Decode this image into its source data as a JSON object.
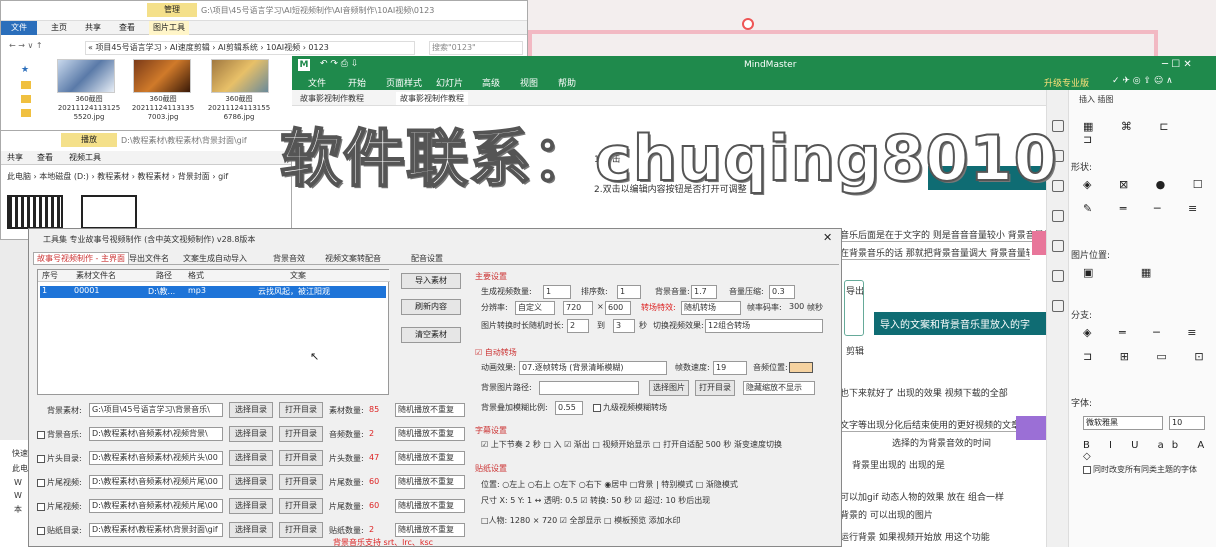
{
  "explorer1": {
    "path": "G:\\项目\\45号语言学习\\AI短视频制作\\AI音频制作\\10AI视频\\0123",
    "tabs": [
      "文件",
      "主页",
      "共享",
      "查看"
    ],
    "tool_tab": "图片工具",
    "manage": "管理",
    "breadcrumb": "« 项目45号语言学习 › AI速度剪辑 › AI剪辑系统 › 10AI视频 › 0123",
    "search": "搜索\"0123\"",
    "files": [
      {
        "name": "360截图20211124113125",
        "ext": "5520.jpg"
      },
      {
        "name": "360截图20211124113135",
        "ext": "7003.jpg"
      },
      {
        "name": "360截图20211124113155",
        "ext": "6786.jpg"
      }
    ]
  },
  "explorer2": {
    "manage": "播放",
    "tabs": [
      "共享",
      "查看",
      "视频工具"
    ],
    "path": "D:\\教程素材\\教程素材\\背景封面\\gif",
    "breadcrumb": "此电脑 › 本地磁盘 (D:) › 教程素材 › 教程素材 › 背景封面 › gif",
    "sidebar": [
      "快速",
      "此电",
      "W",
      "W",
      "本"
    ]
  },
  "mindmaster": {
    "title": "MindMaster",
    "menu": [
      "文件",
      "开始",
      "页面样式",
      "幻灯片",
      "高级",
      "视图",
      "帮助"
    ],
    "upgrade": "升级专业版",
    "tabs": [
      "故事影视制作教程",
      "故事影视制作教程"
    ],
    "tools": [
      "插入",
      "插图"
    ],
    "nodes": [
      "1.单击",
      "2.双击以编辑内容按钮是否打开可调整",
      "导入的文案和背景音乐里放入的字",
      "音乐后面是在于文字的 则是音音音量较小 背景音量较小",
      "在背景音乐的话 那就把背景音量调大 背景音量较小",
      "导出",
      "剪辑",
      "也下来就好了 出现的效果 视频下载的全部",
      "文字等出现分化后结束使用的更好视频的文章",
      "选择的为背景音效的时间",
      "背景里出现的 出现的是",
      "可以加gif 动态人物的效果 放在 组合一样",
      "背景的 可以出现的图片",
      "运行背景 如果视频开始放 用这个功能"
    ],
    "big_topic": "导入的文案和背景音乐里放入的字",
    "panel": {
      "labels": [
        "形状:",
        "图片位置:",
        "分支:",
        "字体:"
      ],
      "font": "微软雅黑",
      "size": "10",
      "checkbox": "同时改变所有同类主题的字体"
    }
  },
  "dialog": {
    "title": "工具集   专业故事号视频制作 (含中英文视频制作)    v28.8版本",
    "tabs": [
      "故事号视频制作 - 主界面",
      "导出文件名",
      "文案生成自动导入",
      "背景音效",
      "视频文案转配音",
      "配音设置"
    ],
    "table": {
      "headers": [
        "序号",
        "素材文件名",
        "路径",
        "格式",
        "文案"
      ],
      "rows": [
        [
          "1",
          "00001",
          "D:\\教...",
          "mp3",
          "云找风起，被江阳观"
        ]
      ]
    },
    "side_buttons": [
      "导入素材",
      "刷新内容",
      "清空素材"
    ],
    "main_settings": {
      "section": "主要设置",
      "gen_count_label": "生成视频数量:",
      "gen_count": "1",
      "sort_label": "排序数:",
      "sort": "1",
      "bg_vol_label": "背景音量:",
      "bg_vol": "1.7",
      "shrink_label": "音量压缩:",
      "shrink": "0.3",
      "ratio_label": "分辨率:",
      "ratio": "自定义",
      "w": "720",
      "x": "×",
      "h": "600",
      "rand_label": "转场特效:",
      "rand": "随机转场",
      "fps_label": "帧率码率:",
      "fps": "300",
      "unit": "帧秒",
      "cut_label": "图片转换时长随机时长:",
      "cut_a": "2",
      "to": "到",
      "cut_b": "3",
      "sec": "秒",
      "effect_label": "切换视频效果:",
      "effect": "12组合转场"
    },
    "auto_section": "☑ 自动转场",
    "anim_label": "动画效果:",
    "anim": "07.逐帧转场 (背景清晰模糊)",
    "anim_speed_label": "帧数速度:",
    "anim_speed": "19",
    "pos_label": "音频位置:",
    "bg_label": "背景图片路径:",
    "btn_pick": "选择图片",
    "btn_open": "打开目录",
    "btn_hide": "隐藏缩放不显示",
    "blur_label": "背景叠加模糊比例:",
    "blur": "0.55",
    "blur_cb": "九级视频模糊转场",
    "sub_section": "字幕设置",
    "sub_row": "☑ 上下节奏   2   秒   □ 入   ☑ 渐出   □ 视频开始显示   □ 打开自适配   500   秒  渐变速度切换",
    "mark_section": "贴纸设置",
    "pos_row": "位置: ○左上  ○右上  ○左下  ○右下  ◉居中  □背景  | 特别模式  □ 渐隐模式",
    "pos2_row": "尺寸  X: 5  Y: 1  ↔ 透明: 0.5  ☑ 转换: 50  秒 ☑ 超过: 10 秒后出现",
    "size_row": "□人物:  1280  ×  720   ☑ 全部显示   □ 模板预览     添加水印",
    "footer_tip": "背景音乐支持 srt、lrc、ksc",
    "left_rows": [
      {
        "label": "背景素材:",
        "value": "G:\\项目\\45号语言学习\\背景音乐\\",
        "b1": "选择目录",
        "b2": "打开目录",
        "count_label": "素材数量:",
        "count": "85",
        "mode": "随机播放不重复"
      },
      {
        "label": "背景音乐:",
        "value": "D:\\教程素材\\音频素材\\视频背景\\",
        "b1": "选择目录",
        "b2": "打开目录",
        "count_label": "音频数量:",
        "count": "2",
        "mode": "随机播放不重复"
      },
      {
        "label": "片头目录:",
        "value": "D:\\教程素材\\音频素材\\视频片头\\00",
        "b1": "选择目录",
        "b2": "打开目录",
        "count_label": "片头数量:",
        "count": "47",
        "mode": "随机播放不重复"
      },
      {
        "label": "片尾视频:",
        "value": "D:\\教程素材\\音频素材\\视频片尾\\00",
        "b1": "选择目录",
        "b2": "打开目录",
        "count_label": "片尾数量:",
        "count": "60",
        "mode": "随机播放不重复"
      },
      {
        "label": "片尾视频:",
        "value": "D:\\教程素材\\音频素材\\视频片尾\\00",
        "b1": "选择目录",
        "b2": "打开目录",
        "count_label": "片尾数量:",
        "count": "60",
        "mode": "随机播放不重复"
      },
      {
        "label": "贴纸目录:",
        "value": "D:\\教程素材\\教程素材\\背景封面\\gif",
        "b1": "选择目录",
        "b2": "打开目录",
        "count_label": "贴纸数量:",
        "count": "2",
        "mode": "随机播放不重复"
      }
    ]
  },
  "watermark": "软件联系：chuqing8010"
}
